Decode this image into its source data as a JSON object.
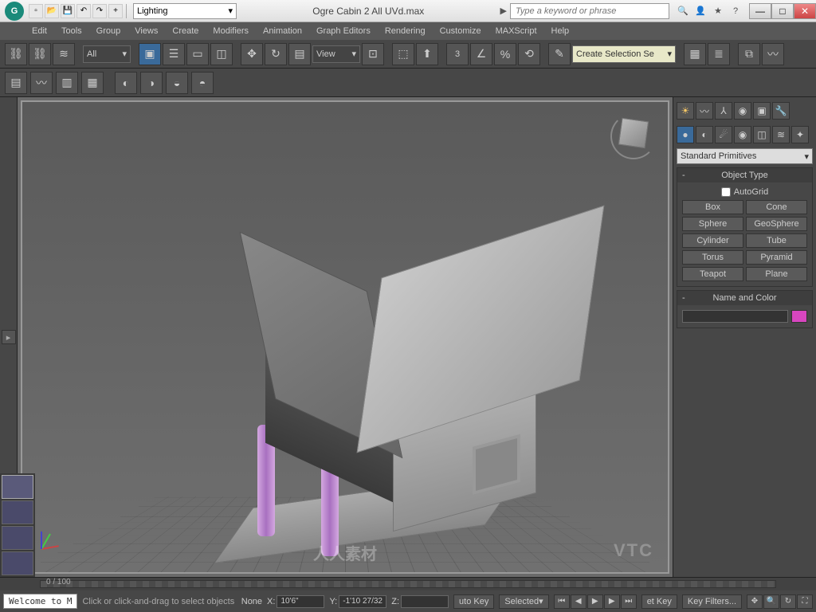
{
  "titlebar": {
    "workspace": "Lighting",
    "filename": "Ogre Cabin 2 All UVd.max",
    "search_placeholder": "Type a keyword or phrase"
  },
  "menu": [
    "Edit",
    "Tools",
    "Group",
    "Views",
    "Create",
    "Modifiers",
    "Animation",
    "Graph Editors",
    "Rendering",
    "Customize",
    "MAXScript",
    "Help"
  ],
  "toolbar": {
    "all_filter": "All",
    "view_mode": "View",
    "angle_snap": "3",
    "selection_set": "Create Selection Se"
  },
  "create_panel": {
    "category": "Standard Primitives",
    "rollout_object_type": "Object Type",
    "autogrid": "AutoGrid",
    "primitives": [
      "Box",
      "Cone",
      "Sphere",
      "GeoSphere",
      "Cylinder",
      "Tube",
      "Torus",
      "Pyramid",
      "Teapot",
      "Plane"
    ],
    "rollout_name_color": "Name and Color"
  },
  "timeline": {
    "frame_display": "0 / 100"
  },
  "statusbar": {
    "welcome": "Welcome to M",
    "hint": "Click or click-and-drag to select objects",
    "none_label": "None",
    "x_label": "X:",
    "x_value": "10'6\"",
    "y_label": "Y:",
    "y_value": "-1'10 27/32",
    "z_label": "Z:",
    "autokey": "uto Key",
    "setkey": "et Key",
    "selected": "Selected",
    "keyfilters": "Key Filters..."
  },
  "watermark_vtc": "VTC",
  "watermark_site": "人人素材"
}
